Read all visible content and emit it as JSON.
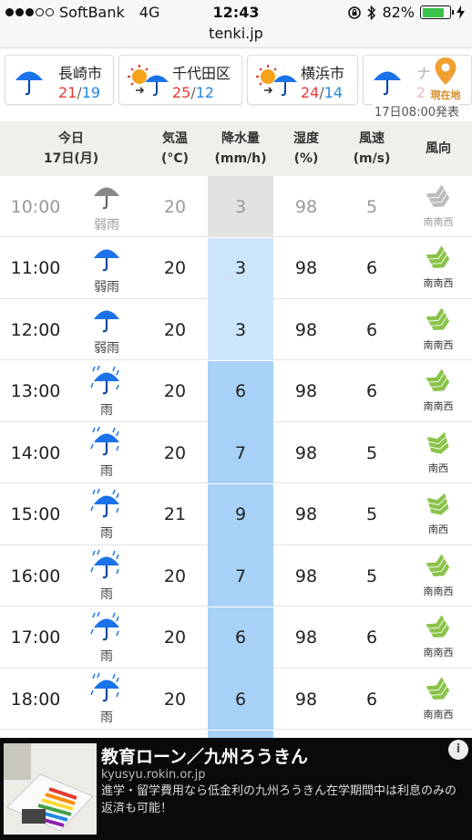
{
  "status": {
    "carrier": "SoftBank",
    "network": "4G",
    "time": "12:43",
    "battery": "82%",
    "battery_level": 0.82
  },
  "browser": {
    "url": "tenki.jp"
  },
  "cities": [
    {
      "name": "長崎市",
      "high": "21",
      "low": "19",
      "icon": "umbrella-icon"
    },
    {
      "name": "千代田区",
      "high": "25",
      "low": "12",
      "icon": "sun-to-rain-icon"
    },
    {
      "name": "横浜市",
      "high": "24",
      "low": "14",
      "icon": "sun-to-rain-icon"
    },
    {
      "name": "ナ",
      "high": "2",
      "low": "",
      "icon": "umbrella-icon"
    }
  ],
  "location_button": {
    "label": "現在地"
  },
  "issued": "17日08:00発表",
  "table": {
    "headers": {
      "day": "今日",
      "date": "17日(月)",
      "temp": "気温",
      "temp_unit": "(°C)",
      "rain": "降水量",
      "rain_unit": "(mm/h)",
      "humidity": "湿度",
      "humidity_unit": "(%)",
      "wind": "風速",
      "wind_unit": "(m/s)",
      "direction": "風向"
    },
    "rows": [
      {
        "time": "10:00",
        "weather": "弱雨",
        "temp": "20",
        "rain": "3",
        "humidity": "98",
        "wind": "5",
        "direction": "南南西"
      },
      {
        "time": "11:00",
        "weather": "弱雨",
        "temp": "20",
        "rain": "3",
        "humidity": "98",
        "wind": "6",
        "direction": "南南西"
      },
      {
        "time": "12:00",
        "weather": "弱雨",
        "temp": "20",
        "rain": "3",
        "humidity": "98",
        "wind": "6",
        "direction": "南南西"
      },
      {
        "time": "13:00",
        "weather": "雨",
        "temp": "20",
        "rain": "6",
        "humidity": "98",
        "wind": "6",
        "direction": "南南西"
      },
      {
        "time": "14:00",
        "weather": "雨",
        "temp": "20",
        "rain": "7",
        "humidity": "98",
        "wind": "5",
        "direction": "南西"
      },
      {
        "time": "15:00",
        "weather": "雨",
        "temp": "21",
        "rain": "9",
        "humidity": "98",
        "wind": "5",
        "direction": "南西"
      },
      {
        "time": "16:00",
        "weather": "雨",
        "temp": "20",
        "rain": "7",
        "humidity": "98",
        "wind": "5",
        "direction": "南南西"
      },
      {
        "time": "17:00",
        "weather": "雨",
        "temp": "20",
        "rain": "6",
        "humidity": "98",
        "wind": "6",
        "direction": "南南西"
      },
      {
        "time": "18:00",
        "weather": "雨",
        "temp": "20",
        "rain": "6",
        "humidity": "98",
        "wind": "6",
        "direction": "南南西"
      }
    ]
  },
  "ad": {
    "title": "教育ローン／九州ろうきん",
    "url": "kyusyu.rokin.or.jp",
    "description": "進学・留学費用なら低金利の九州ろうきん在学期間中は利息のみの返済も可能！"
  },
  "colors": {
    "rain_light": "#cde5fb",
    "rain_mid": "#a7d1f7",
    "rain_past": "#e2e2e2",
    "umbrella": "#1a73e8",
    "wind_arrow": "#8bc34a",
    "high_temp": "#e53935",
    "low_temp": "#1e88e5"
  }
}
